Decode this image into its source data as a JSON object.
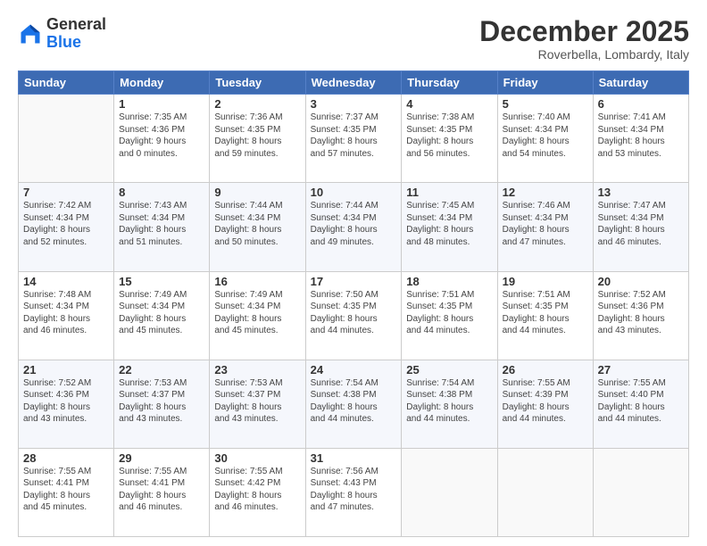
{
  "logo": {
    "general": "General",
    "blue": "Blue"
  },
  "header": {
    "month": "December 2025",
    "location": "Roverbella, Lombardy, Italy"
  },
  "weekdays": [
    "Sunday",
    "Monday",
    "Tuesday",
    "Wednesday",
    "Thursday",
    "Friday",
    "Saturday"
  ],
  "weeks": [
    [
      {
        "day": "",
        "info": ""
      },
      {
        "day": "1",
        "info": "Sunrise: 7:35 AM\nSunset: 4:36 PM\nDaylight: 9 hours\nand 0 minutes."
      },
      {
        "day": "2",
        "info": "Sunrise: 7:36 AM\nSunset: 4:35 PM\nDaylight: 8 hours\nand 59 minutes."
      },
      {
        "day": "3",
        "info": "Sunrise: 7:37 AM\nSunset: 4:35 PM\nDaylight: 8 hours\nand 57 minutes."
      },
      {
        "day": "4",
        "info": "Sunrise: 7:38 AM\nSunset: 4:35 PM\nDaylight: 8 hours\nand 56 minutes."
      },
      {
        "day": "5",
        "info": "Sunrise: 7:40 AM\nSunset: 4:34 PM\nDaylight: 8 hours\nand 54 minutes."
      },
      {
        "day": "6",
        "info": "Sunrise: 7:41 AM\nSunset: 4:34 PM\nDaylight: 8 hours\nand 53 minutes."
      }
    ],
    [
      {
        "day": "7",
        "info": "Sunrise: 7:42 AM\nSunset: 4:34 PM\nDaylight: 8 hours\nand 52 minutes."
      },
      {
        "day": "8",
        "info": "Sunrise: 7:43 AM\nSunset: 4:34 PM\nDaylight: 8 hours\nand 51 minutes."
      },
      {
        "day": "9",
        "info": "Sunrise: 7:44 AM\nSunset: 4:34 PM\nDaylight: 8 hours\nand 50 minutes."
      },
      {
        "day": "10",
        "info": "Sunrise: 7:44 AM\nSunset: 4:34 PM\nDaylight: 8 hours\nand 49 minutes."
      },
      {
        "day": "11",
        "info": "Sunrise: 7:45 AM\nSunset: 4:34 PM\nDaylight: 8 hours\nand 48 minutes."
      },
      {
        "day": "12",
        "info": "Sunrise: 7:46 AM\nSunset: 4:34 PM\nDaylight: 8 hours\nand 47 minutes."
      },
      {
        "day": "13",
        "info": "Sunrise: 7:47 AM\nSunset: 4:34 PM\nDaylight: 8 hours\nand 46 minutes."
      }
    ],
    [
      {
        "day": "14",
        "info": "Sunrise: 7:48 AM\nSunset: 4:34 PM\nDaylight: 8 hours\nand 46 minutes."
      },
      {
        "day": "15",
        "info": "Sunrise: 7:49 AM\nSunset: 4:34 PM\nDaylight: 8 hours\nand 45 minutes."
      },
      {
        "day": "16",
        "info": "Sunrise: 7:49 AM\nSunset: 4:34 PM\nDaylight: 8 hours\nand 45 minutes."
      },
      {
        "day": "17",
        "info": "Sunrise: 7:50 AM\nSunset: 4:35 PM\nDaylight: 8 hours\nand 44 minutes."
      },
      {
        "day": "18",
        "info": "Sunrise: 7:51 AM\nSunset: 4:35 PM\nDaylight: 8 hours\nand 44 minutes."
      },
      {
        "day": "19",
        "info": "Sunrise: 7:51 AM\nSunset: 4:35 PM\nDaylight: 8 hours\nand 44 minutes."
      },
      {
        "day": "20",
        "info": "Sunrise: 7:52 AM\nSunset: 4:36 PM\nDaylight: 8 hours\nand 43 minutes."
      }
    ],
    [
      {
        "day": "21",
        "info": "Sunrise: 7:52 AM\nSunset: 4:36 PM\nDaylight: 8 hours\nand 43 minutes."
      },
      {
        "day": "22",
        "info": "Sunrise: 7:53 AM\nSunset: 4:37 PM\nDaylight: 8 hours\nand 43 minutes."
      },
      {
        "day": "23",
        "info": "Sunrise: 7:53 AM\nSunset: 4:37 PM\nDaylight: 8 hours\nand 43 minutes."
      },
      {
        "day": "24",
        "info": "Sunrise: 7:54 AM\nSunset: 4:38 PM\nDaylight: 8 hours\nand 44 minutes."
      },
      {
        "day": "25",
        "info": "Sunrise: 7:54 AM\nSunset: 4:38 PM\nDaylight: 8 hours\nand 44 minutes."
      },
      {
        "day": "26",
        "info": "Sunrise: 7:55 AM\nSunset: 4:39 PM\nDaylight: 8 hours\nand 44 minutes."
      },
      {
        "day": "27",
        "info": "Sunrise: 7:55 AM\nSunset: 4:40 PM\nDaylight: 8 hours\nand 44 minutes."
      }
    ],
    [
      {
        "day": "28",
        "info": "Sunrise: 7:55 AM\nSunset: 4:41 PM\nDaylight: 8 hours\nand 45 minutes."
      },
      {
        "day": "29",
        "info": "Sunrise: 7:55 AM\nSunset: 4:41 PM\nDaylight: 8 hours\nand 46 minutes."
      },
      {
        "day": "30",
        "info": "Sunrise: 7:55 AM\nSunset: 4:42 PM\nDaylight: 8 hours\nand 46 minutes."
      },
      {
        "day": "31",
        "info": "Sunrise: 7:56 AM\nSunset: 4:43 PM\nDaylight: 8 hours\nand 47 minutes."
      },
      {
        "day": "",
        "info": ""
      },
      {
        "day": "",
        "info": ""
      },
      {
        "day": "",
        "info": ""
      }
    ]
  ]
}
